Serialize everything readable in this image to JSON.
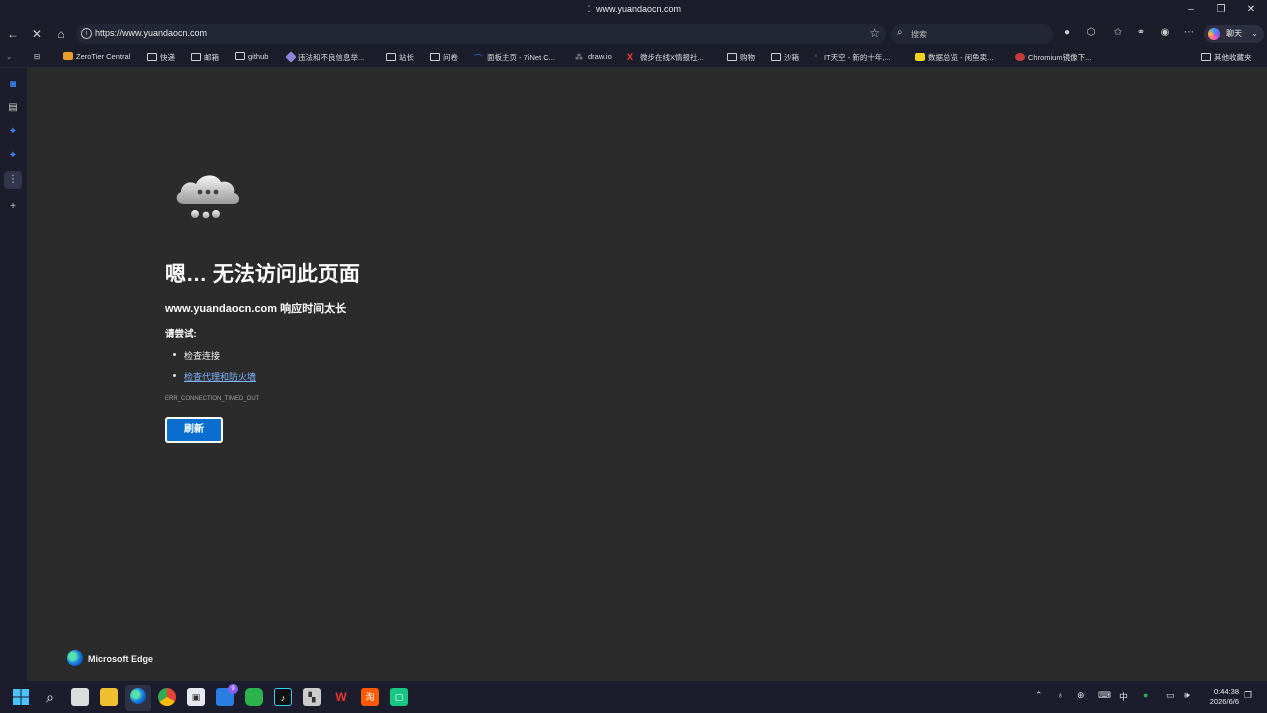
{
  "window": {
    "title": "www.yuandaocn.com"
  },
  "toolbar": {
    "url": "https://www.yuandaocn.com",
    "search_placeholder": "搜索",
    "chat_label": "聊天"
  },
  "bookmarks": [
    {
      "label": "ZeroTier Central",
      "icon": "zerotier-icon"
    },
    {
      "label": "快递",
      "icon": "folder-icon"
    },
    {
      "label": "邮箱",
      "icon": "folder-icon"
    },
    {
      "label": "github",
      "icon": "folder-icon"
    },
    {
      "label": "违法和不良信息举...",
      "icon": "report-icon"
    },
    {
      "label": "站长",
      "icon": "folder-icon"
    },
    {
      "label": "问卷",
      "icon": "folder-icon"
    },
    {
      "label": "面板主页 - 7iNet C...",
      "icon": "panel-icon"
    },
    {
      "label": "draw.io",
      "icon": "drawio-icon"
    },
    {
      "label": "微步在线X情报社...",
      "icon": "threatbook-icon"
    },
    {
      "label": "购物",
      "icon": "folder-icon"
    },
    {
      "label": "沙箱",
      "icon": "folder-icon"
    },
    {
      "label": "IT天空 - 新的十年,...",
      "icon": "itsk-icon"
    },
    {
      "label": "数据总览 - 闲鱼卖...",
      "icon": "xianyu-icon"
    },
    {
      "label": "Chromium镜像下...",
      "icon": "chromium-icon"
    }
  ],
  "other_bookmarks": "其他收藏夹",
  "error": {
    "title": "嗯… 无法访问此页面",
    "subtitle": "www.yuandaocn.com 响应时间太长",
    "try_label": "请尝试:",
    "suggestions": [
      "检查连接",
      "检查代理和防火墙"
    ],
    "code": "ERR_CONNECTION_TIMED_OUT",
    "refresh_label": "刷新"
  },
  "brand": "Microsoft Edge",
  "taskbar": {
    "mail_badge": "9",
    "ime": "中",
    "time": "0:44:38",
    "date": "2026/6/6"
  },
  "colors": {
    "accent": "#0a6ed1",
    "link": "#7fb3ff",
    "page_bg": "#2b2b2b",
    "chrome_bg": "#1b1d2a"
  }
}
